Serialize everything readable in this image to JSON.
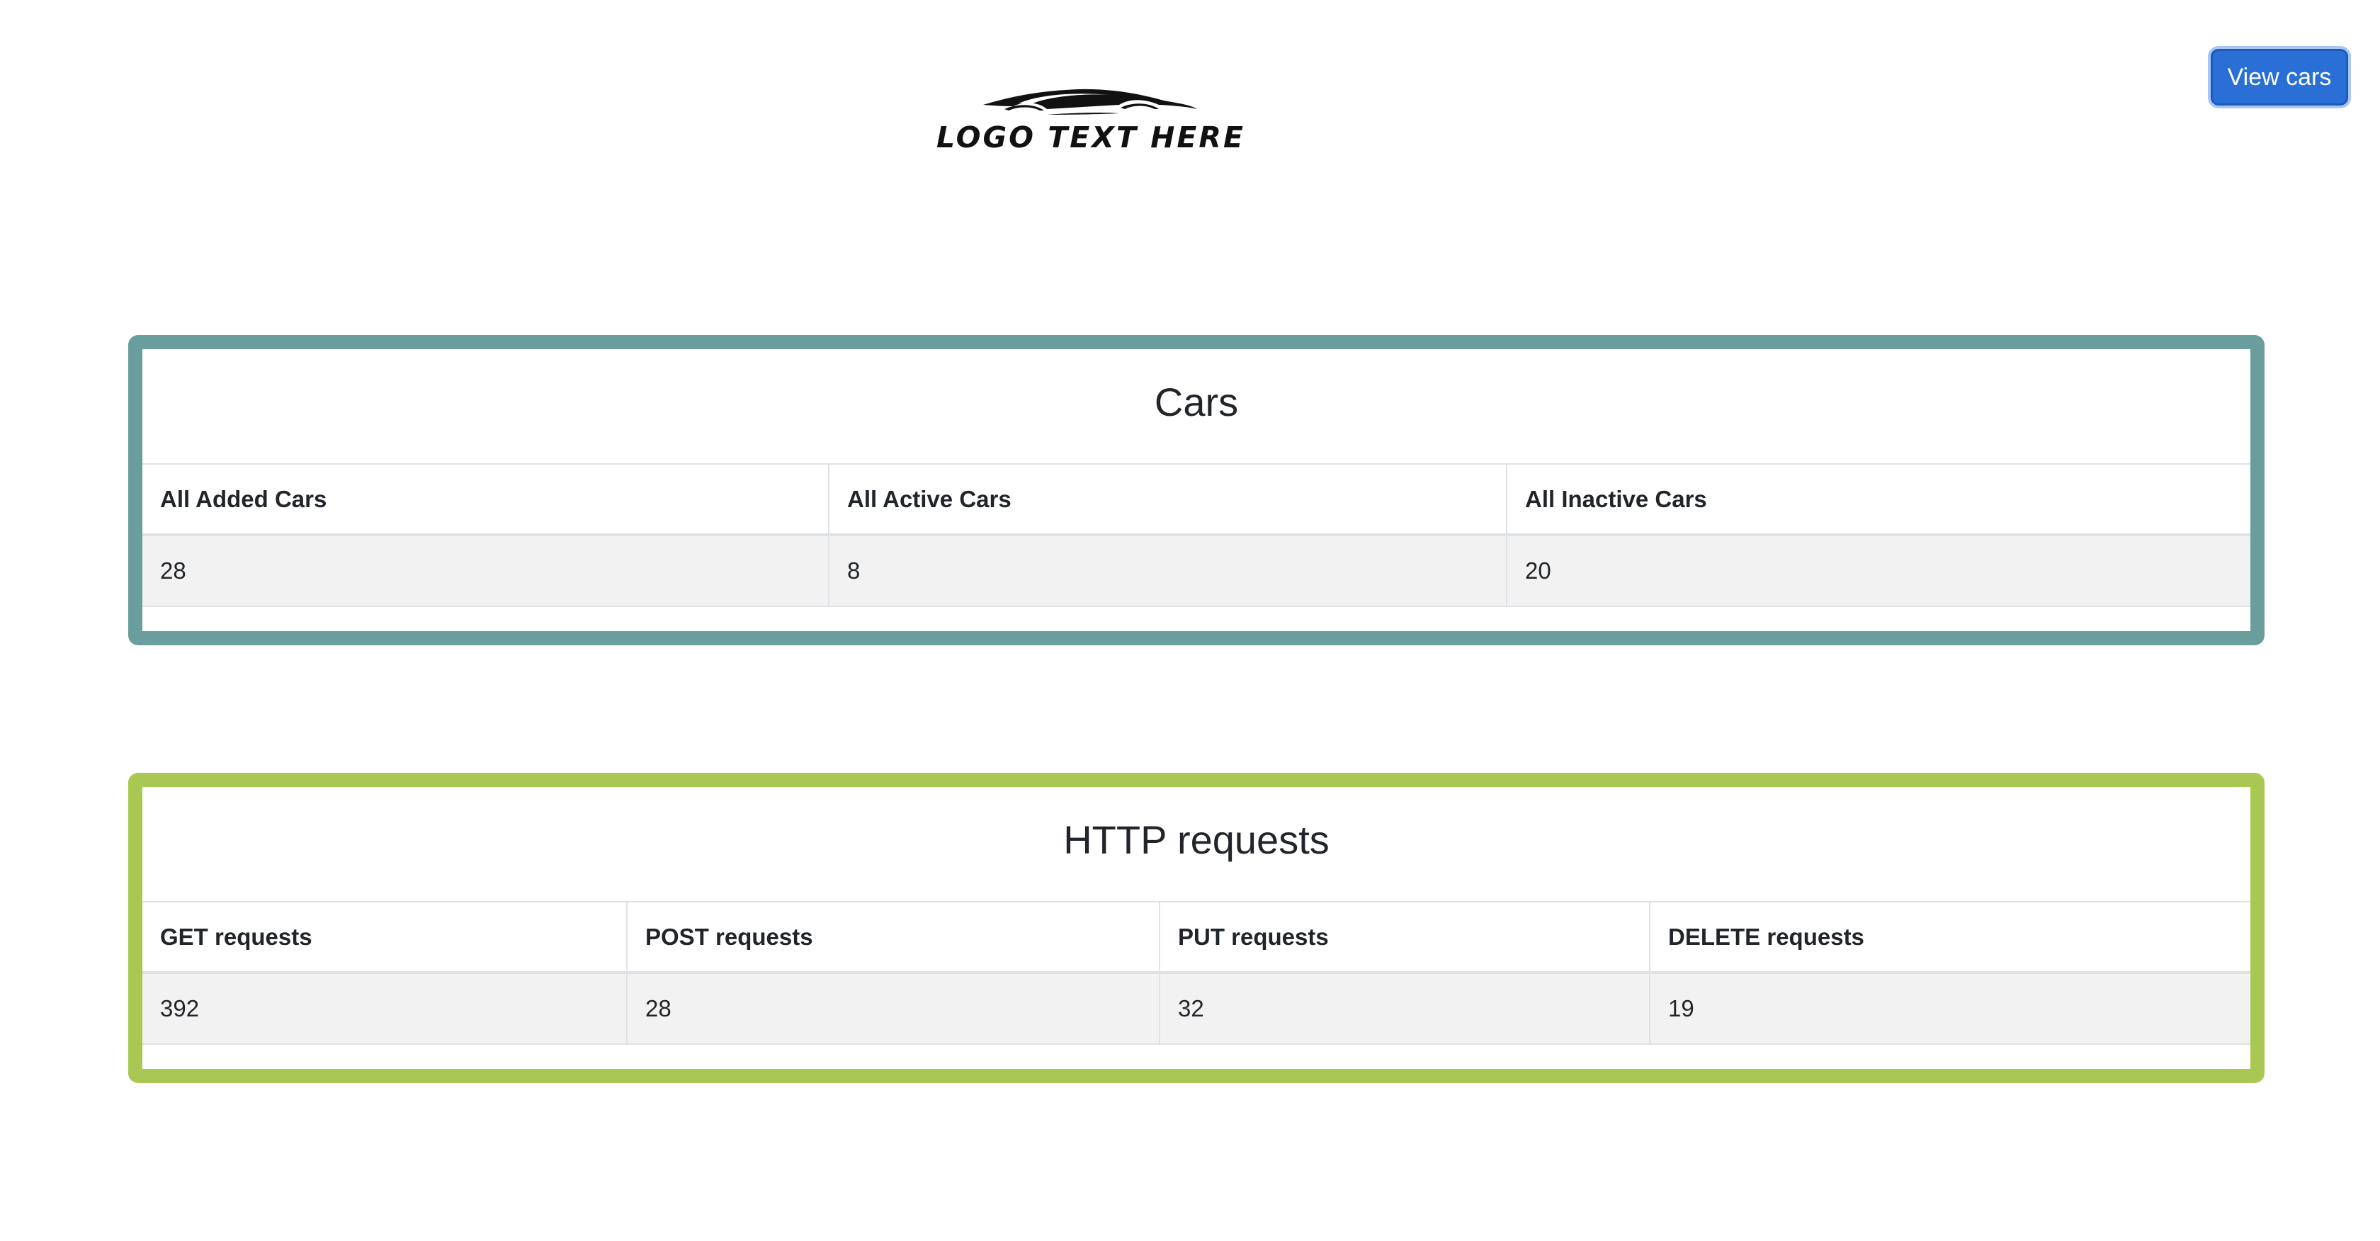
{
  "header": {
    "logo_text": "LOGO TEXT HERE",
    "view_cars_label": "View cars"
  },
  "cars": {
    "title": "Cars",
    "columns": [
      "All Added Cars",
      "All Active Cars",
      "All Inactive Cars"
    ],
    "values": [
      "28",
      "8",
      "20"
    ],
    "border_color": "#6a9d9d"
  },
  "http": {
    "title": "HTTP requests",
    "columns": [
      "GET requests",
      "POST requests",
      "PUT requests",
      "DELETE requests"
    ],
    "values": [
      "392",
      "28",
      "32",
      "19"
    ],
    "border_color": "#a8c853"
  },
  "colors": {
    "primary_button": "#2a6fd6",
    "row_background": "#f2f2f2"
  }
}
